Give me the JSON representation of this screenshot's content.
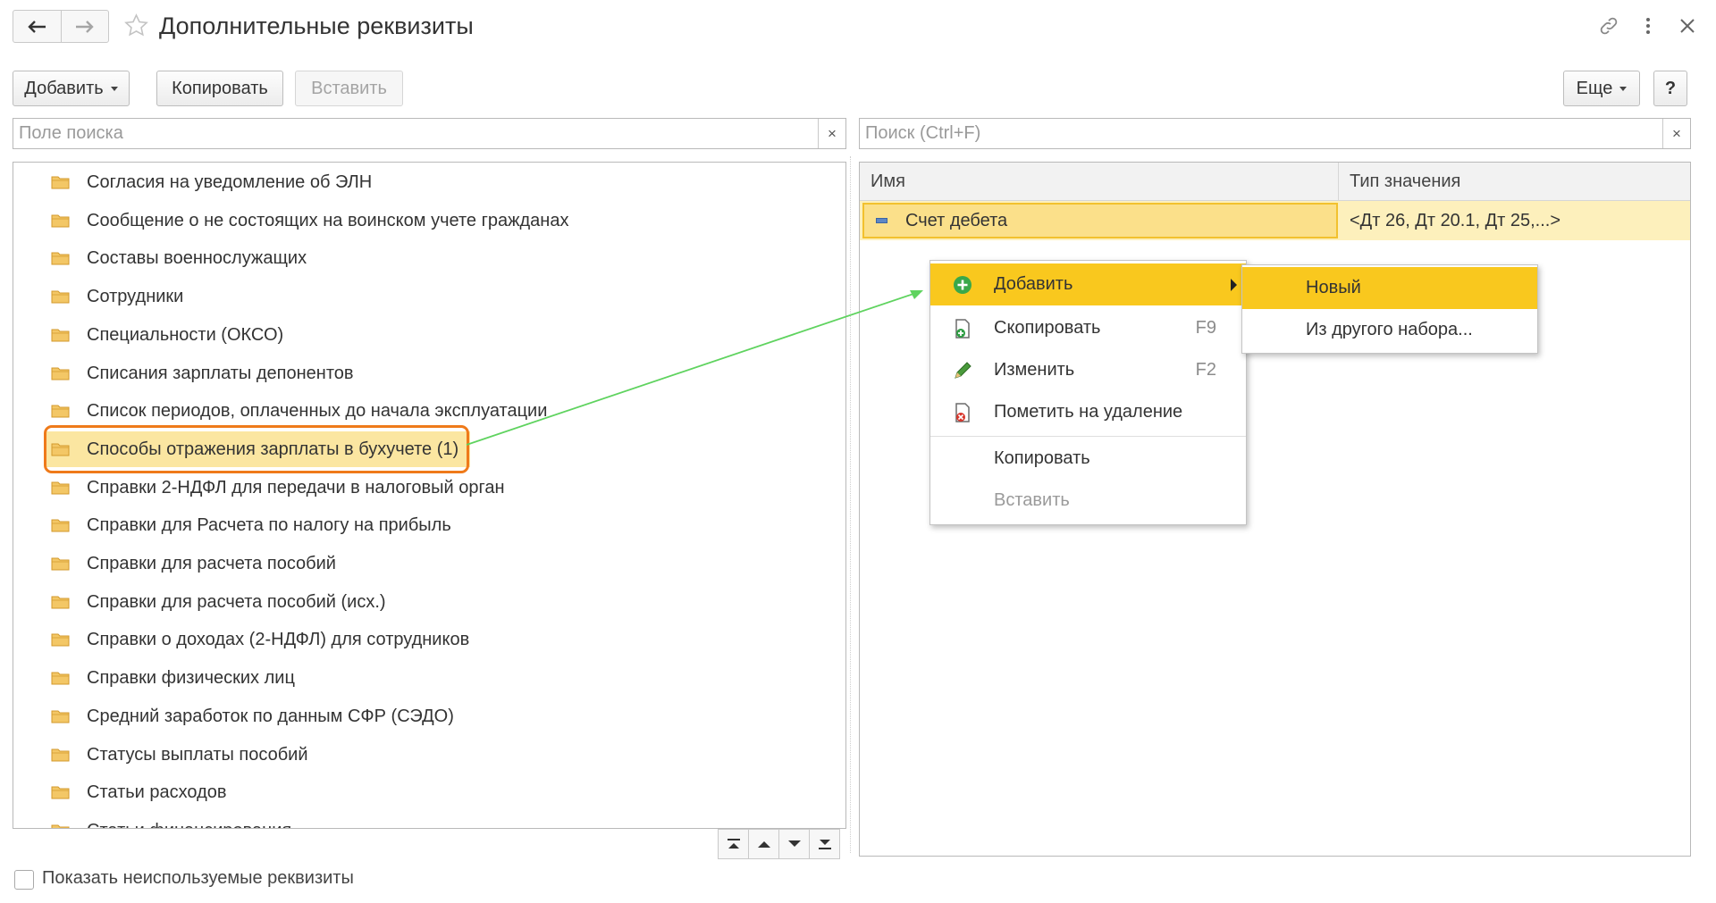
{
  "window": {
    "title": "Дополнительные реквизиты"
  },
  "toolbar": {
    "add_label": "Добавить",
    "copy_label": "Копировать",
    "paste_label": "Вставить",
    "more_label": "Еще",
    "help_label": "?"
  },
  "left_search": {
    "placeholder": "Поле поиска",
    "clear": "×"
  },
  "right_search": {
    "placeholder": "Поиск (Ctrl+F)",
    "clear": "×"
  },
  "tree": {
    "items": [
      {
        "label": "Согласия на уведомление об ЭЛН"
      },
      {
        "label": "Сообщение о не состоящих на воинском учете гражданах"
      },
      {
        "label": "Составы военнослужащих"
      },
      {
        "label": "Сотрудники"
      },
      {
        "label": "Специальности (ОКСО)"
      },
      {
        "label": "Списания зарплаты депонентов"
      },
      {
        "label": "Список периодов, оплаченных до начала эксплуатации"
      },
      {
        "label": "Способы отражения зарплаты в бухучете (1)",
        "selected": true
      },
      {
        "label": "Справки 2-НДФЛ для передачи в налоговый орган"
      },
      {
        "label": "Справки для Расчета по налогу на прибыль"
      },
      {
        "label": "Справки для расчета пособий"
      },
      {
        "label": "Справки для расчета пособий (исх.)"
      },
      {
        "label": "Справки о доходах (2-НДФЛ) для сотрудников"
      },
      {
        "label": "Справки физических лиц"
      },
      {
        "label": "Средний заработок по данным СФР (СЭДО)"
      },
      {
        "label": "Статусы выплаты пособий"
      },
      {
        "label": "Статьи расходов"
      },
      {
        "label": "Статьи финансирования"
      }
    ]
  },
  "show_unused_label": "Показать неиспользуемые реквизиты",
  "grid": {
    "columns": [
      "Имя",
      "Тип значения"
    ],
    "rows": [
      {
        "name": "Счет дебета",
        "type": "<Дт 26, Дт 20.1, Дт 25,...>"
      }
    ]
  },
  "context_menu": {
    "items": [
      {
        "label": "Добавить",
        "shortcut": "",
        "icon": "add-circle-icon"
      },
      {
        "label": "Скопировать",
        "shortcut": "F9",
        "icon": "copy-doc-icon"
      },
      {
        "label": "Изменить",
        "shortcut": "F2",
        "icon": "pencil-icon"
      },
      {
        "label": "Пометить на удаление",
        "shortcut": "",
        "icon": "delete-mark-icon"
      },
      {
        "label": "Копировать",
        "shortcut": ""
      },
      {
        "label": "Вставить",
        "shortcut": ""
      }
    ]
  },
  "submenu": {
    "items": [
      {
        "label": "Новый"
      },
      {
        "label": "Из другого набора..."
      }
    ]
  },
  "colors": {
    "accent_yellow": "#f9c81e",
    "selection": "#fbe6a1",
    "highlight_ring": "#ef7a1a",
    "arrow": "#5fd35f"
  }
}
